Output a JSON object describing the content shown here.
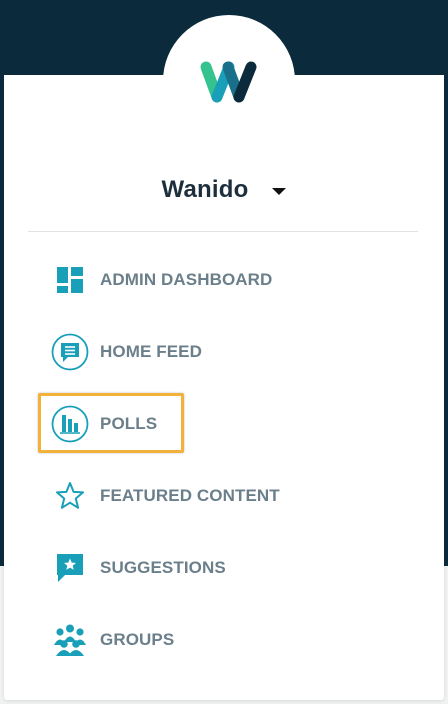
{
  "header": {
    "org_name": "Wanido",
    "logo_icon": "wanido-logo",
    "dropdown_icon": "caret-down-icon"
  },
  "colors": {
    "brand_dark": "#0b2b3c",
    "icon_teal": "#1a9fb8",
    "label_gray": "#6b7f8b",
    "highlight": "#f1b13b"
  },
  "nav": {
    "items": [
      {
        "label": "ADMIN DASHBOARD",
        "icon": "dashboard-icon"
      },
      {
        "label": "HOME FEED",
        "icon": "feed-icon"
      },
      {
        "label": "POLLS",
        "icon": "polls-icon"
      },
      {
        "label": "FEATURED CONTENT",
        "icon": "star-icon"
      },
      {
        "label": "SUGGESTIONS",
        "icon": "suggestions-icon"
      },
      {
        "label": "GROUPS",
        "icon": "groups-icon"
      }
    ]
  }
}
